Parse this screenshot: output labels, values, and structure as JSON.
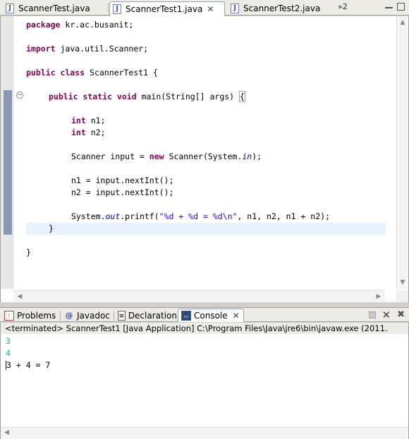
{
  "editor_tabs": [
    {
      "label": "ScannerTest.java",
      "active": false
    },
    {
      "label": "ScannerTest1.java",
      "active": true
    },
    {
      "label": "ScannerTest2.java",
      "active": false
    }
  ],
  "overflow_label": "»2",
  "code": {
    "l1_kw": "package",
    "l1_rest": " kr.ac.busanit;",
    "l2_kw": "import",
    "l2_rest": " java.util.Scanner;",
    "l3_kw": "public class",
    "l3_rest": " ScannerTest1 {",
    "l4_kw": "public static void",
    "l4_rest": " main(String[] args) ",
    "l4_brace": "{",
    "l5_kw": "int",
    "l5_rest": " n1;",
    "l6_kw": "int",
    "l6_rest": " n2;",
    "l7_a": "Scanner input = ",
    "l7_kw": "new",
    "l7_b": " Scanner(System.",
    "l7_fld": "in",
    "l7_c": ");",
    "l8": "n1 = input.nextInt();",
    "l9": "n2 = input.nextInt();",
    "l10_a": "System.",
    "l10_fld": "out",
    "l10_b": ".printf(",
    "l10_str": "\"%d + %d = %d\\n\"",
    "l10_c": ", n1, n2, n1 + n2);",
    "l11": "}",
    "l12": "}"
  },
  "views": [
    {
      "label": "Problems",
      "icon": "problems-icon"
    },
    {
      "label": "Javadoc",
      "icon": "javadoc-icon",
      "glyph": "@"
    },
    {
      "label": "Declaration",
      "icon": "declaration-icon"
    },
    {
      "label": "Console",
      "icon": "console-icon",
      "active": true
    }
  ],
  "console": {
    "status": "<terminated> ScannerTest1 [Java Application] C:\\Program Files\\Java\\jre6\\bin\\javaw.exe (2011.",
    "input1": "3",
    "input2": "4",
    "output": "3 + 4 = 7"
  },
  "colors": {
    "keyword": "#7f0055",
    "string": "#2a00ff",
    "field": "#0000c0",
    "console_input": "#2aa9a0"
  }
}
